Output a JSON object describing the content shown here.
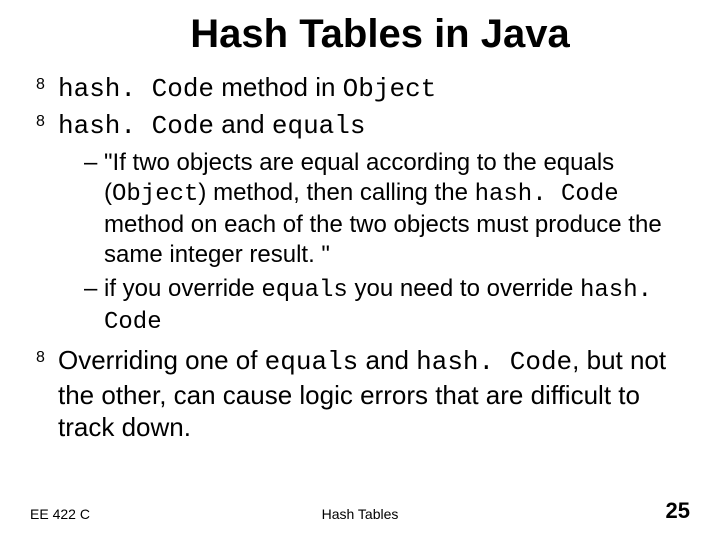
{
  "title": "Hash Tables in Java",
  "b1": {
    "c1": "hash. Code",
    "t1": " method in ",
    "c2": "Object"
  },
  "b2": {
    "c1": "hash. Code",
    "t1": "  and ",
    "c2": "equals"
  },
  "sub1": {
    "t1": "\"If two objects are equal according to the equals (",
    "c1": "Object",
    "t2": ") method, then calling the ",
    "c2": "hash. Code",
    "t3": " method on each of the two objects must produce the same integer result. \""
  },
  "sub2": {
    "t1": "if you override ",
    "c1": "equals",
    "t2": " you need to override ",
    "c2": "hash. Code"
  },
  "b3": {
    "t1": "Overriding one of ",
    "c1": "equals",
    "t2": " and ",
    "c2": "hash. Code",
    "t3": ", but not the other, can cause logic errors that are difficult to track down."
  },
  "footer": {
    "left": "EE 422 C",
    "center": "Hash Tables",
    "page": "25"
  }
}
